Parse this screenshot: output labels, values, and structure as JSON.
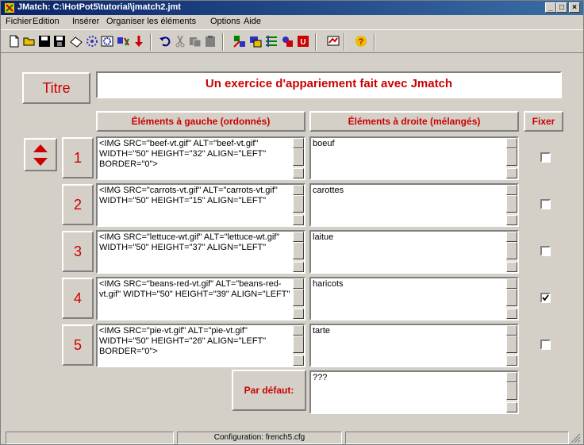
{
  "window": {
    "title": "JMatch: C:\\HotPot5\\tutorial\\jmatch2.jmt"
  },
  "menu": [
    "Fichier",
    "Edition",
    "Insérer",
    "Organiser les éléments",
    "Options",
    "Aide"
  ],
  "toolbar": {
    "icons": [
      "new-file-icon",
      "open-folder-icon",
      "save-icon",
      "save-as-icon",
      "clear-icon",
      "web-page-icon",
      "web-page-alt-icon",
      "add-item-icon",
      "down-arrow-icon",
      "undo-icon",
      "cut-icon",
      "copy-icon",
      "paste-icon",
      "config-1-icon",
      "config-2-icon",
      "config-3-icon",
      "config-4-icon",
      "unicode-icon",
      "update-icon",
      "help-icon"
    ]
  },
  "title_label": "Titre",
  "title_value": "Un exercice d'appariement fait avec Jmatch",
  "headers": {
    "left": "Éléments à gauche (ordonnés)",
    "right": "Éléments à droite (mélangés)",
    "fix": "Fixer"
  },
  "rows": [
    {
      "num": "1",
      "left": "<IMG SRC=\"beef-vt.gif\" ALT=\"beef-vt.gif\" WIDTH=\"50\" HEIGHT=\"32\" ALIGN=\"LEFT\" BORDER=\"0\">",
      "right": "boeuf",
      "fixed": false
    },
    {
      "num": "2",
      "left": "<IMG SRC=\"carrots-vt.gif\" ALT=\"carrots-vt.gif\" WIDTH=\"50\" HEIGHT=\"15\" ALIGN=\"LEFT\"",
      "right": "carottes",
      "fixed": false
    },
    {
      "num": "3",
      "left": "<IMG SRC=\"lettuce-wt.gif\" ALT=\"lettuce-wt.gif\" WIDTH=\"50\" HEIGHT=\"37\" ALIGN=\"LEFT\"",
      "right": "laitue",
      "fixed": false
    },
    {
      "num": "4",
      "left": "<IMG SRC=\"beans-red-vt.gif\" ALT=\"beans-red-vt.gif\" WIDTH=\"50\" HEIGHT=\"39\" ALIGN=\"LEFT\"",
      "right": "haricots",
      "fixed": true
    },
    {
      "num": "5",
      "left": "<IMG SRC=\"pie-vt.gif\" ALT=\"pie-vt.gif\" WIDTH=\"50\" HEIGHT=\"26\" ALIGN=\"LEFT\" BORDER=\"0\">",
      "right": "tarte",
      "fixed": false
    }
  ],
  "default": {
    "label": "Par défaut:",
    "value": "???"
  },
  "status": {
    "config": "Configuration: french5.cfg"
  },
  "colors": {
    "accent": "#cc0000",
    "face": "#d4d0c8",
    "title_bar": "#0a246a"
  }
}
